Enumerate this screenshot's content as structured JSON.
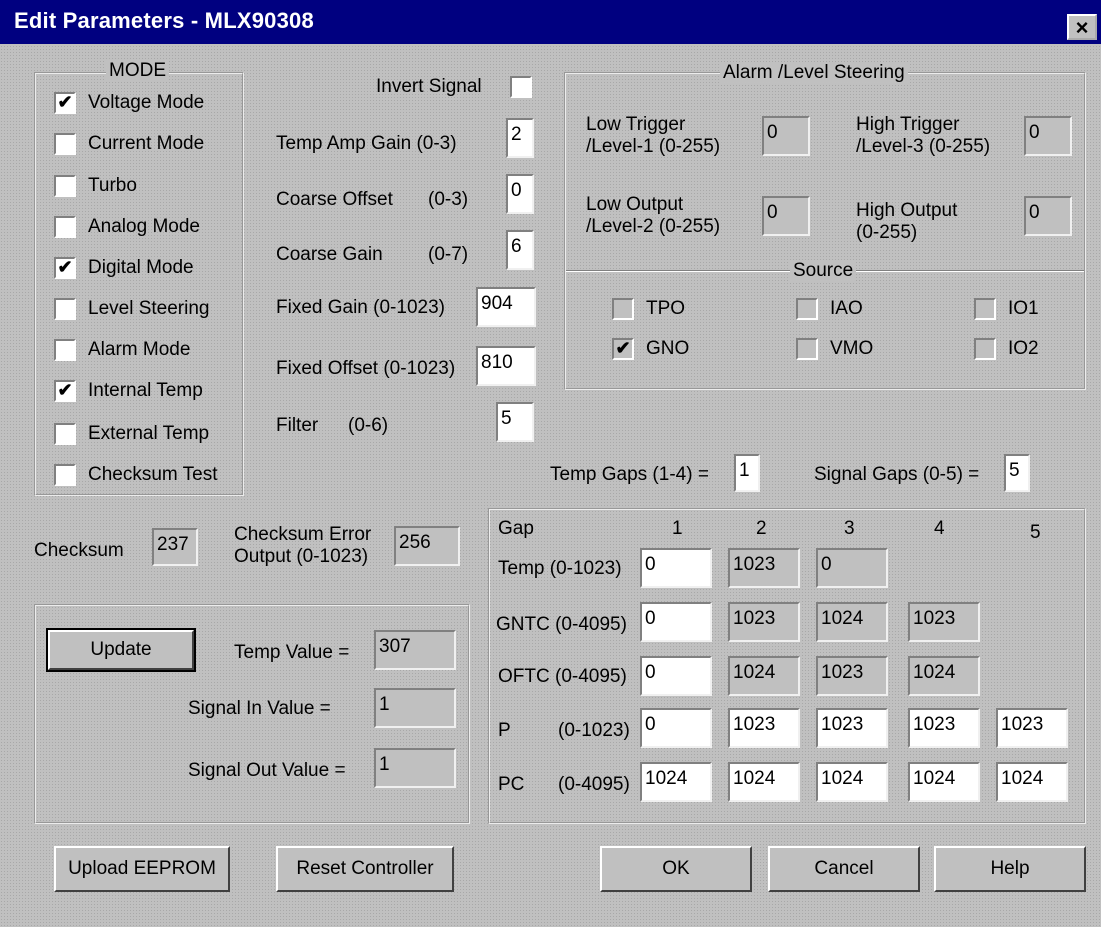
{
  "window": {
    "title": "Edit Parameters  -  MLX90308",
    "close": "×"
  },
  "mode": {
    "caption": "MODE",
    "items": [
      {
        "label": "Voltage Mode",
        "mark": "✔"
      },
      {
        "label": "Current Mode",
        "mark": ""
      },
      {
        "label": "Turbo",
        "mark": ""
      },
      {
        "label": "Analog Mode",
        "mark": ""
      },
      {
        "label": "Digital Mode",
        "mark": "✔"
      },
      {
        "label": "Level Steering",
        "mark": ""
      },
      {
        "label": "Alarm Mode",
        "mark": ""
      },
      {
        "label": "Internal Temp",
        "mark": "✔"
      },
      {
        "label": "External Temp",
        "mark": ""
      },
      {
        "label": "Checksum Test",
        "mark": ""
      }
    ]
  },
  "params": {
    "invert_label": "Invert Signal",
    "invert_mark": "",
    "temp_amp_label": "Temp Amp Gain (0-3)",
    "temp_amp": "2",
    "coarse_offset_label": "Coarse Offset",
    "coarse_offset_range": "(0-3)",
    "coarse_offset": "0",
    "coarse_gain_label": "Coarse Gain",
    "coarse_gain_range": "(0-7)",
    "coarse_gain": "6",
    "fixed_gain_label": "Fixed Gain  (0-1023)",
    "fixed_gain": "904",
    "fixed_offset_label": "Fixed Offset (0-1023)",
    "fixed_offset": "810",
    "filter_label": "Filter",
    "filter_range": "(0-6)",
    "filter": "5"
  },
  "alarm": {
    "caption": "Alarm /Level Steering",
    "low_trigger_l1": "Low Trigger",
    "low_trigger_l2": "/Level-1  (0-255)",
    "low_trigger": "0",
    "high_trigger_l1": "High Trigger",
    "high_trigger_l2": "/Level-3  (0-255)",
    "high_trigger": "0",
    "low_output_l1": "Low Output",
    "low_output_l2": "/Level-2  (0-255)",
    "low_output": "0",
    "high_output_l1": "High Output",
    "high_output_l2": "(0-255)",
    "high_output": "0",
    "source_caption": "Source",
    "sources": [
      {
        "label": "TPO",
        "mark": ""
      },
      {
        "label": "IAO",
        "mark": ""
      },
      {
        "label": "IO1",
        "mark": ""
      },
      {
        "label": "GNO",
        "mark": "✔"
      },
      {
        "label": "VMO",
        "mark": ""
      },
      {
        "label": "IO2",
        "mark": ""
      }
    ]
  },
  "gaps": {
    "temp_gaps_label": "Temp Gaps (1-4) =",
    "temp_gaps": "1",
    "signal_gaps_label": "Signal Gaps (0-5) =",
    "signal_gaps": "5",
    "header": "Gap",
    "cols": [
      "1",
      "2",
      "3",
      "4",
      "5"
    ],
    "rows": [
      {
        "label": "Temp  (0-1023)",
        "values": [
          "0",
          "1023",
          "0"
        ]
      },
      {
        "label": "GNTC (0-4095)",
        "values": [
          "0",
          "1023",
          "1024",
          "1023"
        ]
      },
      {
        "label": "OFTC (0-4095)",
        "values": [
          "0",
          "1024",
          "1023",
          "1024"
        ]
      },
      {
        "label": "P",
        "range": "(0-1023)",
        "values": [
          "0",
          "1023",
          "1023",
          "1023",
          "1023"
        ]
      },
      {
        "label": "PC",
        "range": "(0-4095)",
        "values": [
          "1024",
          "1024",
          "1024",
          "1024",
          "1024"
        ]
      }
    ]
  },
  "checksum": {
    "label": "Checksum",
    "value": "237",
    "err_l1": "Checksum Error",
    "err_l2": "Output (0-1023)",
    "err_value": "256"
  },
  "update": {
    "button": "Update",
    "temp_label": "Temp Value =",
    "temp_value": "307",
    "signal_in_label": "Signal In Value =",
    "signal_in": "1",
    "signal_out_label": "Signal Out Value =",
    "signal_out": "1"
  },
  "buttons": {
    "upload": "Upload EEPROM",
    "reset": "Reset Controller",
    "ok": "OK",
    "cancel": "Cancel",
    "help": "Help"
  }
}
